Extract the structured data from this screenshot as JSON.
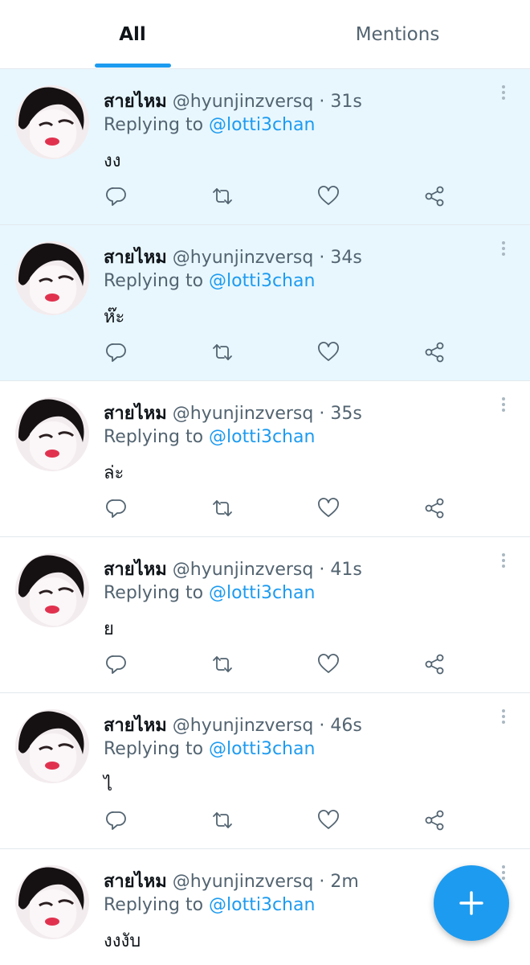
{
  "tabs": [
    {
      "label": "All",
      "active": true
    },
    {
      "label": "Mentions",
      "active": false
    }
  ],
  "colors": {
    "accent": "#1d9bf0",
    "unread_background": "#e8f7fe",
    "secondary_text": "#536471"
  },
  "icons": {
    "reply": "reply-icon",
    "retweet": "retweet-icon",
    "like": "heart-icon",
    "share": "share-icon",
    "more": "more-vertical-icon",
    "compose": "plus-icon"
  },
  "notifications": [
    {
      "display_name": "สายไหม",
      "handle": "@hyunjinzversq",
      "separator": "·",
      "time": "31s",
      "replying_prefix": "Replying to",
      "replying_to": "@lotti3chan",
      "text": "งง",
      "unread": true
    },
    {
      "display_name": "สายไหม",
      "handle": "@hyunjinzversq",
      "separator": "·",
      "time": "34s",
      "replying_prefix": "Replying to",
      "replying_to": "@lotti3chan",
      "text": "ห๊ะ",
      "unread": true
    },
    {
      "display_name": "สายไหม",
      "handle": "@hyunjinzversq",
      "separator": "·",
      "time": "35s",
      "replying_prefix": "Replying to",
      "replying_to": "@lotti3chan",
      "text": "ล่ะ",
      "unread": false
    },
    {
      "display_name": "สายไหม",
      "handle": "@hyunjinzversq",
      "separator": "·",
      "time": "41s",
      "replying_prefix": "Replying to",
      "replying_to": "@lotti3chan",
      "text": "ย",
      "unread": false
    },
    {
      "display_name": "สายไหม",
      "handle": "@hyunjinzversq",
      "separator": "·",
      "time": "46s",
      "replying_prefix": "Replying to",
      "replying_to": "@lotti3chan",
      "text": "ไ",
      "unread": false
    },
    {
      "display_name": "สายไหม",
      "handle": "@hyunjinzversq",
      "separator": "·",
      "time": "2m",
      "replying_prefix": "Replying to",
      "replying_to": "@lotti3chan",
      "text": "งงงับ",
      "unread": false
    }
  ]
}
